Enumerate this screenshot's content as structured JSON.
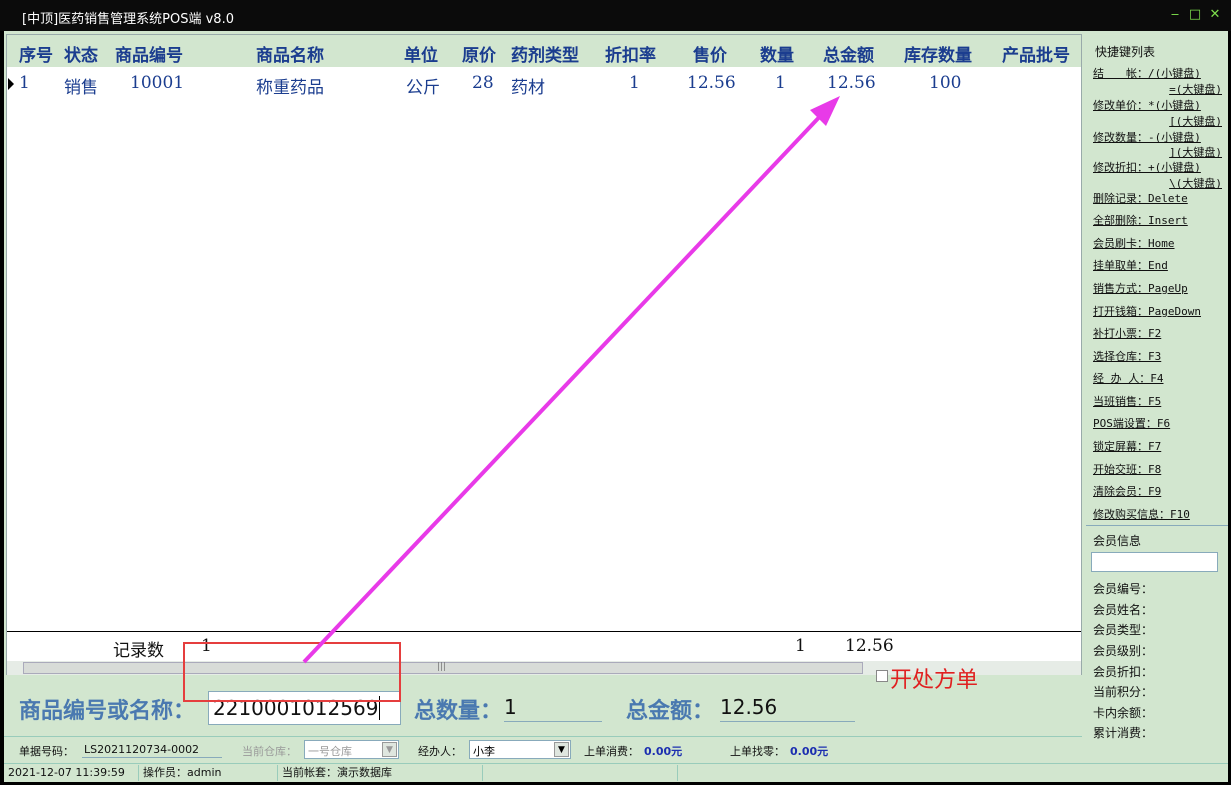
{
  "window": {
    "title": "[中顶]医药销售管理系统POS端 v8.0",
    "min": "‒",
    "max": "□",
    "close": "✕"
  },
  "grid": {
    "headers": [
      "序号",
      "状态",
      "商品编号",
      "商品名称",
      "单位",
      "原价",
      "药剂类型",
      "折扣率",
      "售价",
      "数量",
      "总金额",
      "库存数量",
      "产品批号"
    ],
    "rows": [
      [
        "1",
        "销售",
        "10001",
        "称重药品",
        "公斤",
        "28",
        "药材",
        "1",
        "12.56",
        "1",
        "12.56",
        "100",
        ""
      ]
    ],
    "footer": {
      "count_label": "记录数",
      "count": "1",
      "qty": "1",
      "amount": "12.56"
    }
  },
  "shortcuts": {
    "title": "快捷键列表",
    "items": [
      "结　　帐：/(小键盘)",
      "=(大键盘)",
      "修改单价：*(小键盘)",
      "[(大键盘)",
      "修改数量：-(小键盘)",
      "](大键盘)",
      "修改折扣：+(小键盘)",
      "\\(大键盘)",
      "删除记录：Delete",
      "全部删除：Insert",
      "会员刷卡：Home",
      "挂单取单：End",
      "销售方式：PageUp",
      "打开钱箱：PageDown",
      "补打小票：F2",
      "选择仓库：F3",
      "经 办 人：F4",
      "当班销售：F5",
      "POS端设置：F6",
      "锁定屏幕：F7",
      "开始交班：F8",
      "清除会员：F9",
      "修改购买信息：F10"
    ]
  },
  "member": {
    "title": "会员信息",
    "fields": [
      "会员编号：",
      "会员姓名：",
      "会员类型：",
      "会员级别：",
      "会员折扣：",
      "当前积分：",
      "卡内余额：",
      "累计消费："
    ]
  },
  "entry": {
    "code_label": "商品编号或名称：",
    "code_value": "2210001012569",
    "qty_label": "总数量：",
    "qty_value": "1",
    "amount_label": "总金额：",
    "amount_value": "12.56",
    "prescription_label": "开处方单"
  },
  "info": {
    "bill_label": "单据号码：",
    "bill_value": "LS2021120734-0002",
    "warehouse_label": "当前仓库：",
    "warehouse_value": "一号仓库",
    "handler_label": "经办人：",
    "handler_value": "小李",
    "last_spend_label": "上单消费：",
    "last_spend_value": "0.00元",
    "last_change_label": "上单找零：",
    "last_change_value": "0.00元"
  },
  "status": {
    "datetime": "2021-12-07 11:39:59",
    "operator": "操作员：admin",
    "account": "当前帐套：演示数据库"
  },
  "colors": {
    "accent": "#1b3d8f",
    "panel": "#d2e6cf",
    "highlight": "#e53e3e",
    "arrow": "#e83ae8"
  }
}
